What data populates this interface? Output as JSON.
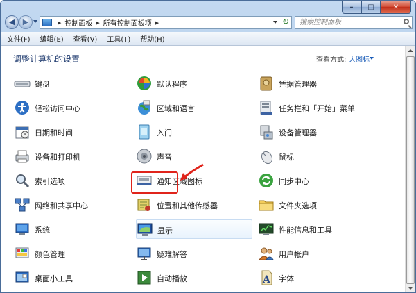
{
  "window": {
    "controls": [
      "–",
      "□",
      "✕"
    ]
  },
  "address_bar": {
    "crumbs": [
      "控制面板",
      "所有控制面板项"
    ]
  },
  "search": {
    "placeholder": "搜索控制面板"
  },
  "menubar": [
    "文件(F)",
    "编辑(E)",
    "查看(V)",
    "工具(T)",
    "帮助(H)"
  ],
  "content": {
    "heading": "调整计算机的设置",
    "view_by_label": "查看方式:",
    "view_by_value": "大图标"
  },
  "items": [
    {
      "label": "键盘",
      "icon": "keyboard-icon"
    },
    {
      "label": "默认程序",
      "icon": "default-programs-icon"
    },
    {
      "label": "凭据管理器",
      "icon": "credential-manager-icon"
    },
    {
      "label": "轻松访问中心",
      "icon": "ease-of-access-icon"
    },
    {
      "label": "区域和语言",
      "icon": "region-language-icon"
    },
    {
      "label": "任务栏和「开始」菜单",
      "icon": "taskbar-start-icon"
    },
    {
      "label": "日期和时间",
      "icon": "date-time-icon"
    },
    {
      "label": "入门",
      "icon": "getting-started-icon"
    },
    {
      "label": "设备管理器",
      "icon": "device-manager-icon"
    },
    {
      "label": "设备和打印机",
      "icon": "devices-printers-icon"
    },
    {
      "label": "声音",
      "icon": "sound-icon"
    },
    {
      "label": "鼠标",
      "icon": "mouse-icon"
    },
    {
      "label": "索引选项",
      "icon": "indexing-options-icon"
    },
    {
      "label": "通知区域图标",
      "icon": "notification-area-icon"
    },
    {
      "label": "同步中心",
      "icon": "sync-center-icon"
    },
    {
      "label": "网络和共享中心",
      "icon": "network-sharing-icon"
    },
    {
      "label": "位置和其他传感器",
      "icon": "location-sensors-icon"
    },
    {
      "label": "文件夹选项",
      "icon": "folder-options-icon"
    },
    {
      "label": "系统",
      "icon": "system-icon"
    },
    {
      "label": "显示",
      "icon": "display-icon"
    },
    {
      "label": "性能信息和工具",
      "icon": "performance-icon"
    },
    {
      "label": "颜色管理",
      "icon": "color-management-icon"
    },
    {
      "label": "疑难解答",
      "icon": "troubleshooting-icon"
    },
    {
      "label": "用户帐户",
      "icon": "user-accounts-icon"
    },
    {
      "label": "桌面小工具",
      "icon": "desktop-gadgets-icon"
    },
    {
      "label": "自动播放",
      "icon": "autoplay-icon"
    },
    {
      "label": "字体",
      "icon": "fonts-icon"
    }
  ],
  "colors": {
    "highlight_box": "#e0241b",
    "heading": "#1e3a6e",
    "link": "#1a5cb8"
  }
}
